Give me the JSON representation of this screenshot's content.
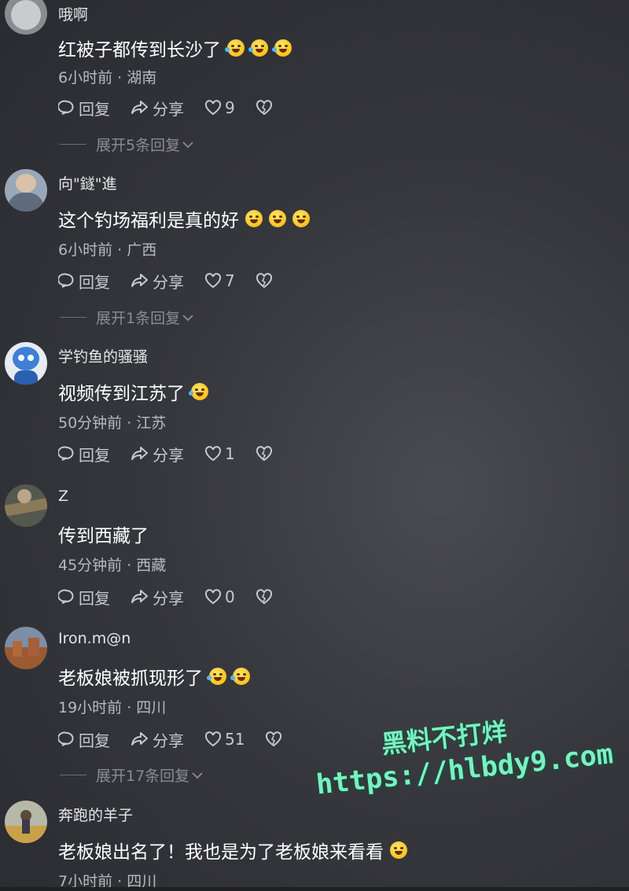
{
  "comments": [
    {
      "username": "哦啊",
      "text": "红被子都传到长沙了",
      "emojis": [
        "laugh",
        "laugh",
        "laugh"
      ],
      "time": "6小时前 · 湖南",
      "reply_label": "回复",
      "share_label": "分享",
      "likes": "9",
      "expand": "展开5条回复"
    },
    {
      "username": "向\"鐩\"進",
      "text": "这个钓场福利是真的好",
      "emojis": [
        "cry",
        "cry",
        "cry"
      ],
      "time": "6小时前 · 广西",
      "reply_label": "回复",
      "share_label": "分享",
      "likes": "7",
      "expand": "展开1条回复"
    },
    {
      "username": "学钓鱼的骚骚",
      "text": "视频传到江苏了",
      "emojis": [
        "laugh"
      ],
      "time": "50分钟前 · 江苏",
      "reply_label": "回复",
      "share_label": "分享",
      "likes": "1",
      "expand": ""
    },
    {
      "username": "Z",
      "text": "传到西藏了",
      "emojis": [],
      "time": "45分钟前 · 西藏",
      "reply_label": "回复",
      "share_label": "分享",
      "likes": "0",
      "expand": ""
    },
    {
      "username": "Iron.m@n",
      "text": "老板娘被抓现形了",
      "emojis": [
        "laugh",
        "laugh"
      ],
      "time": "19小时前 · 四川",
      "reply_label": "回复",
      "share_label": "分享",
      "likes": "51",
      "expand": "展开17条回复"
    },
    {
      "username": "奔跑的羊子",
      "text": "老板娘出名了！我也是为了老板娘来看看",
      "emojis": [
        "smile"
      ],
      "time": "7小时前 · 四川",
      "reply_label": "",
      "share_label": "",
      "likes": "",
      "expand": ""
    }
  ],
  "watermark": {
    "line1": "黑料不打烊",
    "line2": "https://hlbdy9.com"
  },
  "colors": {
    "background": "#36373c",
    "text": "#ffffff",
    "meta": "#b9babd",
    "watermark": "#7af0c0"
  }
}
